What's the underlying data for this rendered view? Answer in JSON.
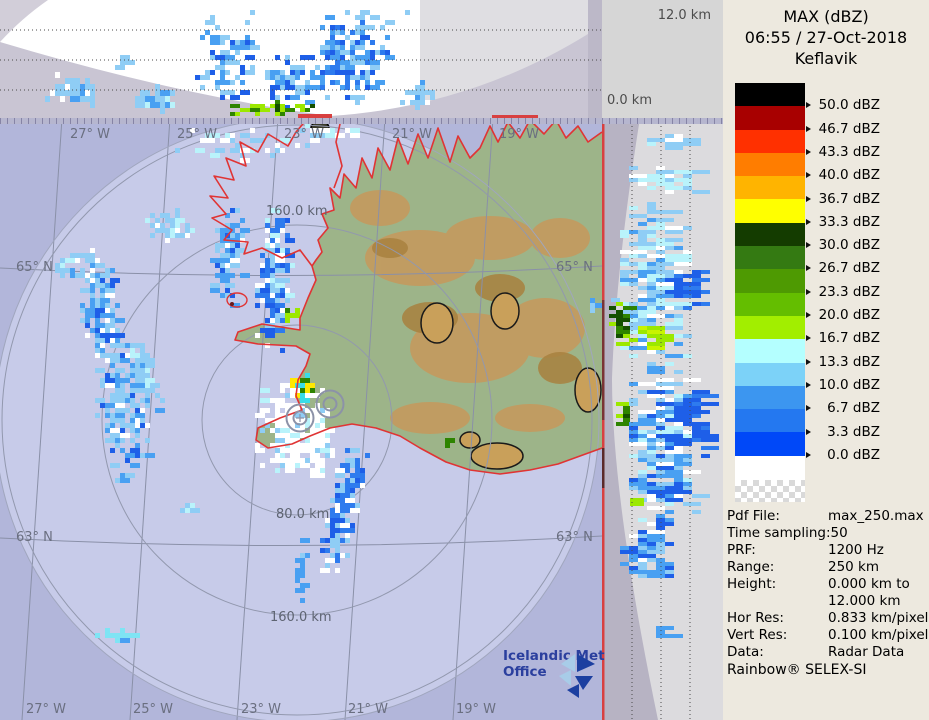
{
  "sidebar": {
    "title": "MAX (dBZ)",
    "datetime": "06:55 / 27-Oct-2018",
    "station": "Keflavik",
    "legend": [
      {
        "color": "#000000",
        "label": "50.0 dBZ"
      },
      {
        "color": "#A80000",
        "label": "46.7 dBZ"
      },
      {
        "color": "#FF3000",
        "label": "43.3 dBZ"
      },
      {
        "color": "#FF7D00",
        "label": "40.0 dBZ"
      },
      {
        "color": "#FFB400",
        "label": "36.7 dBZ"
      },
      {
        "color": "#FFFF00",
        "label": "33.3 dBZ"
      },
      {
        "color": "#143C00",
        "label": "30.0 dBZ"
      },
      {
        "color": "#347A12",
        "label": "26.7 dBZ"
      },
      {
        "color": "#4E9A02",
        "label": "23.3 dBZ"
      },
      {
        "color": "#64BE00",
        "label": "20.0 dBZ"
      },
      {
        "color": "#A2EE00",
        "label": "16.7 dBZ"
      },
      {
        "color": "#B4FFFF",
        "label": "13.3 dBZ"
      },
      {
        "color": "#7CD2F8",
        "label": "10.0 dBZ"
      },
      {
        "color": "#3C96F0",
        "label": "6.7 dBZ"
      },
      {
        "color": "#2478F0",
        "label": "3.3 dBZ"
      },
      {
        "color": "#0048F8",
        "label": "0.0 dBZ"
      }
    ],
    "meta": [
      {
        "label": "Pdf File:",
        "value": "max_250.max"
      },
      {
        "label": "Time sampling:",
        "value": "50"
      },
      {
        "label": "PRF:",
        "value": "1200 Hz"
      },
      {
        "label": "Range:",
        "value": "250 km"
      },
      {
        "label": "Height:",
        "value": "0.000 km to"
      },
      {
        "label": "",
        "value": "12.000 km"
      },
      {
        "label": "Hor Res:",
        "value": "0.833 km/pixel"
      },
      {
        "label": "Vert Res:",
        "value": "0.100 km/pixel"
      },
      {
        "label": "Data:",
        "value": "Radar Data"
      }
    ],
    "footer": "Rainbow® SELEX-SI"
  },
  "height_axis": {
    "max_label": "12.0 km",
    "min_label": "0.0 km"
  },
  "map": {
    "lon_labels_top": [
      "27° W",
      "25° W",
      "23° W",
      "21° W",
      "19° W"
    ],
    "lon_labels_bottom": [
      "27° W",
      "25° W",
      "23° W",
      "21° W",
      "19° W"
    ],
    "lat_labels_left": [
      "65° N",
      "63° N"
    ],
    "lat_labels_right": [
      "65° N",
      "63° N"
    ],
    "range_ring_labels": [
      "160.0 km",
      "80.0 km",
      "160.0 km"
    ],
    "logo_line1": "Icelandic Met",
    "logo_line2": "Office",
    "logo_color": "#2B3F9E",
    "coastline_color": "#E03434",
    "sea_outer_color": "#B2B6DA",
    "sea_inner_color": "#C7CBE9"
  }
}
